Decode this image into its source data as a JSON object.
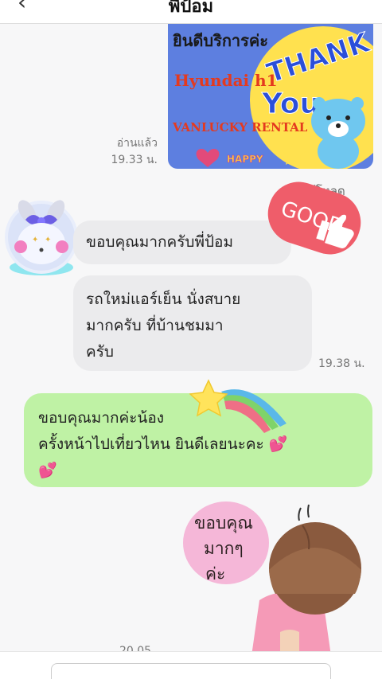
{
  "header": {
    "back_glyph": "‹",
    "title": "พี่ป้อม"
  },
  "messages": {
    "m1": {
      "read_label": "อ่านแล้ว",
      "time": "19.33 น."
    },
    "thanks_sticker": {
      "line1": "ยินดีบริการค่ะ",
      "line2": "Hyundai h1",
      "line3": "VANLUCKY RENTAL",
      "line4": "HAPPY",
      "thank": "THANK",
      "you": "You"
    },
    "download_label": "ดาวน์โหลด",
    "good_text": "GOOD",
    "m2": {
      "text": "ขอบคุณมากครับพี่ป้อม"
    },
    "m3": {
      "line1": "รถใหม่แอร์เย็น นั่งสบาย",
      "line2": "มากครับ ที่บ้านชมมา",
      "line3": "ครับ",
      "time": "19.38 น."
    },
    "m4": {
      "line1": "ขอบคุณมากค่ะน้อง",
      "line2": "ครั้งหน้าไปเที่ยวไหน ยินดีเลยนะคะ 💕",
      "line3": "💕"
    },
    "girl_sticker": {
      "line1": "ขอบคุณ",
      "line2": "มากๆ",
      "line3": "ค่ะ"
    },
    "m5": {
      "time": "20.05"
    }
  },
  "icons": {
    "back": "chevron-left-icon",
    "like": "thumbs-up-icon",
    "heart": "heart-icon"
  },
  "colors": {
    "green_bubble": "#bff2a5",
    "gray_bubble": "#ebebed",
    "good_badge": "#ef5d6a"
  }
}
